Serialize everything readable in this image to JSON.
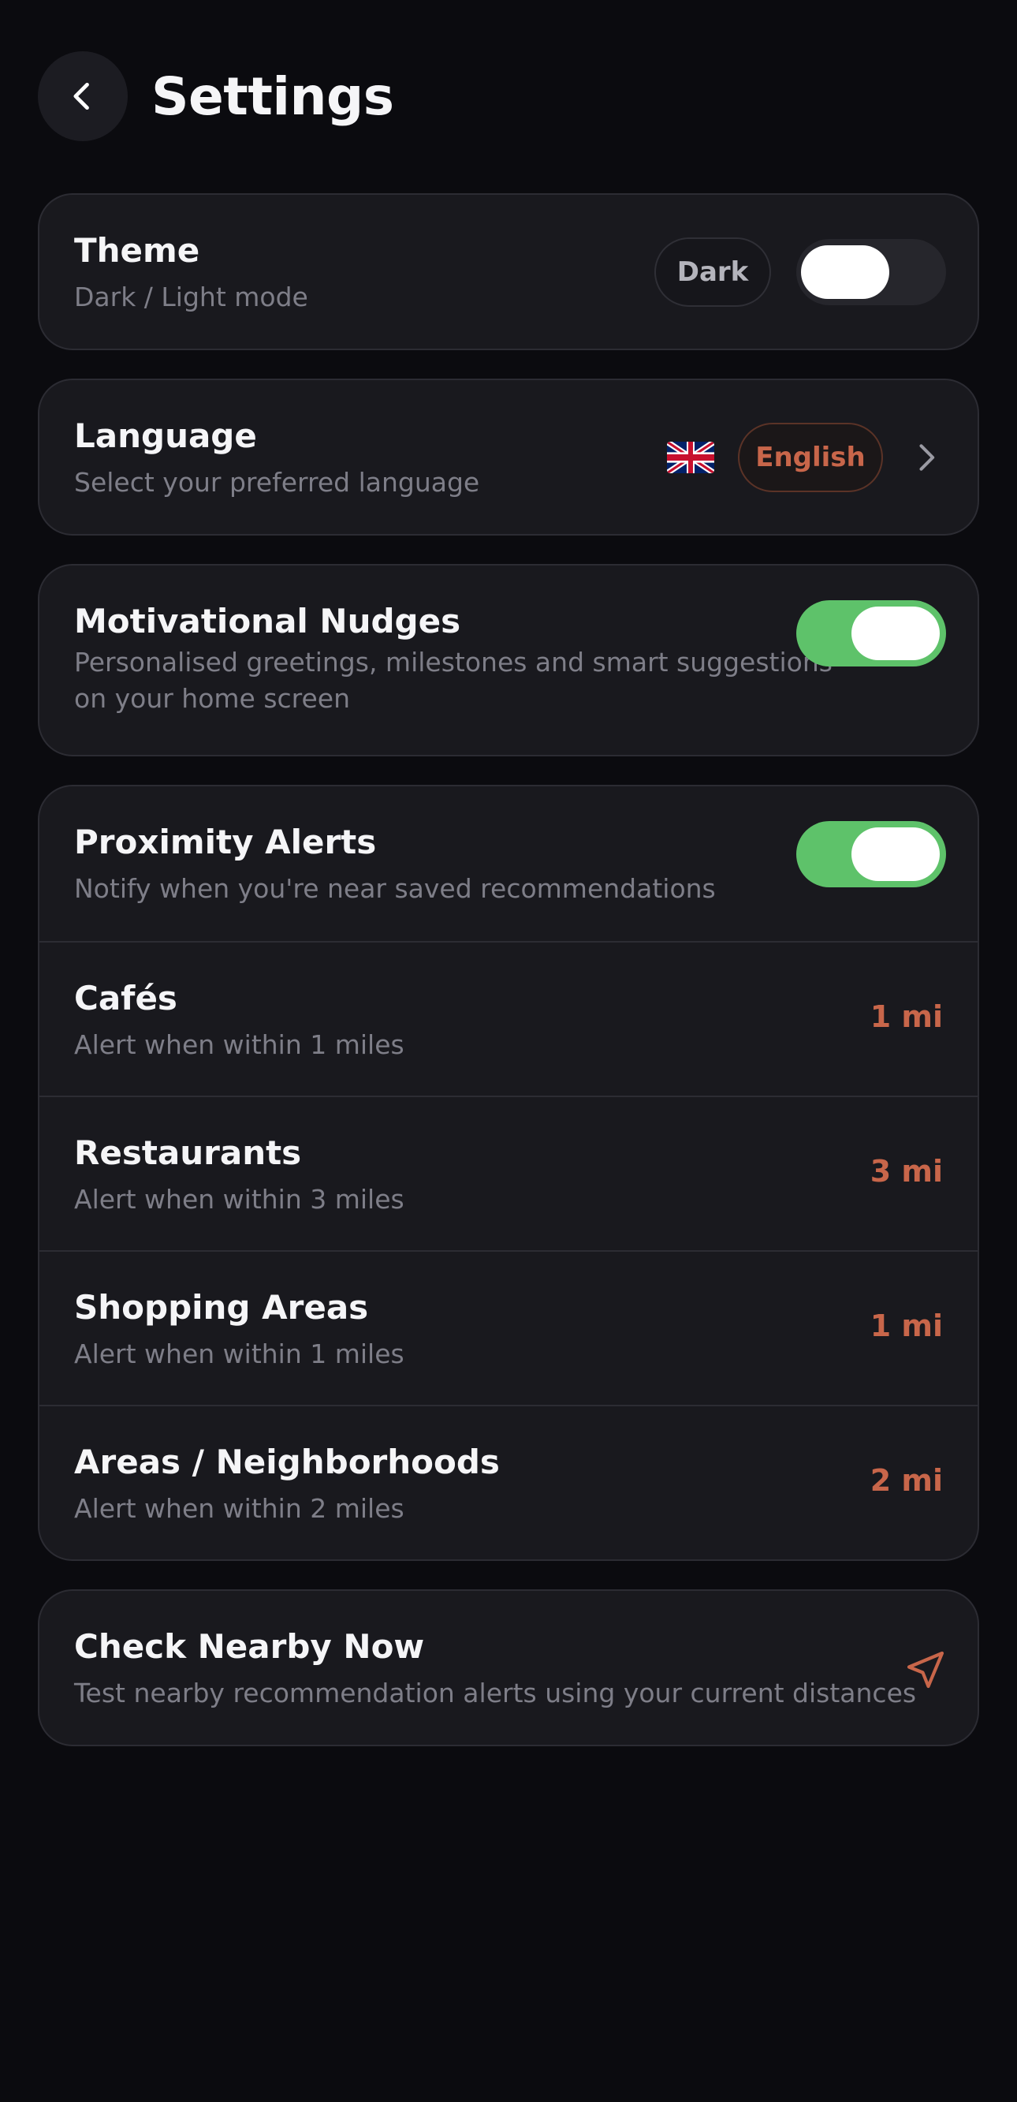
{
  "header": {
    "title": "Settings",
    "back_icon": "chevron-left-icon"
  },
  "theme": {
    "title": "Theme",
    "subtitle": "Dark / Light mode",
    "value": "Dark",
    "toggle_on": false
  },
  "language": {
    "title": "Language",
    "subtitle": "Select your preferred language",
    "value": "English",
    "flag_icon": "uk-flag-icon",
    "chevron_icon": "chevron-right-icon"
  },
  "nudges": {
    "title": "Motivational Nudges",
    "subtitle": "Personalised greetings, milestones and smart suggestions on your home screen",
    "toggle_on": true
  },
  "proximity": {
    "title": "Proximity Alerts",
    "subtitle": "Notify when you're near saved recommendations",
    "toggle_on": true,
    "items": [
      {
        "title": "Cafés",
        "subtitle": "Alert when within 1 miles",
        "distance": "1 mi"
      },
      {
        "title": "Restaurants",
        "subtitle": "Alert when within 3 miles",
        "distance": "3 mi"
      },
      {
        "title": "Shopping Areas",
        "subtitle": "Alert when within 1 miles",
        "distance": "1 mi"
      },
      {
        "title": "Areas / Neighborhoods",
        "subtitle": "Alert when within 2 miles",
        "distance": "2 mi"
      }
    ]
  },
  "check_nearby": {
    "title": "Check Nearby Now",
    "subtitle": "Test nearby recommendation alerts using your current distances",
    "icon": "navigation-arrow-icon"
  },
  "colors": {
    "background": "#0b0b0f",
    "card": "#19191e",
    "accent": "#c8664a",
    "toggle_on": "#5ec26a",
    "toggle_off": "#26262c"
  }
}
